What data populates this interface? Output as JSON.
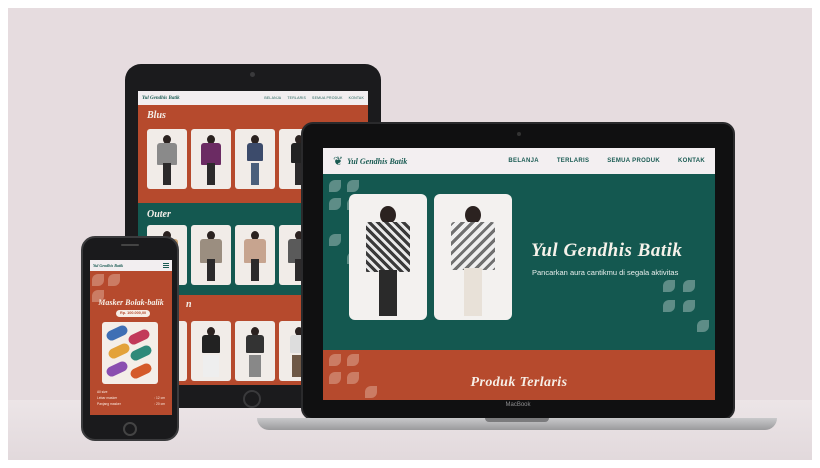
{
  "brand": {
    "name": "Yul Gendhis Batik",
    "tagline": "Pancarkan aura cantikmu di segala aktivitas"
  },
  "nav": {
    "items": [
      "BELANJA",
      "TERLARIS",
      "SEMUA PRODUK",
      "KONTAK"
    ]
  },
  "laptop": {
    "section_title": "Produk Terlaris",
    "device_label": "MacBook"
  },
  "tablet": {
    "sections": [
      {
        "title": "Blus"
      },
      {
        "title": "Outer"
      },
      {
        "title": "n"
      }
    ]
  },
  "phone": {
    "product_title": "Masker Bolak-balik",
    "price": "Rp. 100.000,00",
    "specs": [
      {
        "label": "All size",
        "value": ""
      },
      {
        "label": "Lebar masker",
        "value": ": 12 cm"
      },
      {
        "label": "Panjang masker",
        "value": ": 20 cm"
      }
    ]
  },
  "colors": {
    "teal": "#145850",
    "rust": "#b64a2d",
    "cream": "#f3eff1"
  },
  "icons": {
    "logo": "batik-flower-icon",
    "menu": "hamburger-menu-icon"
  }
}
